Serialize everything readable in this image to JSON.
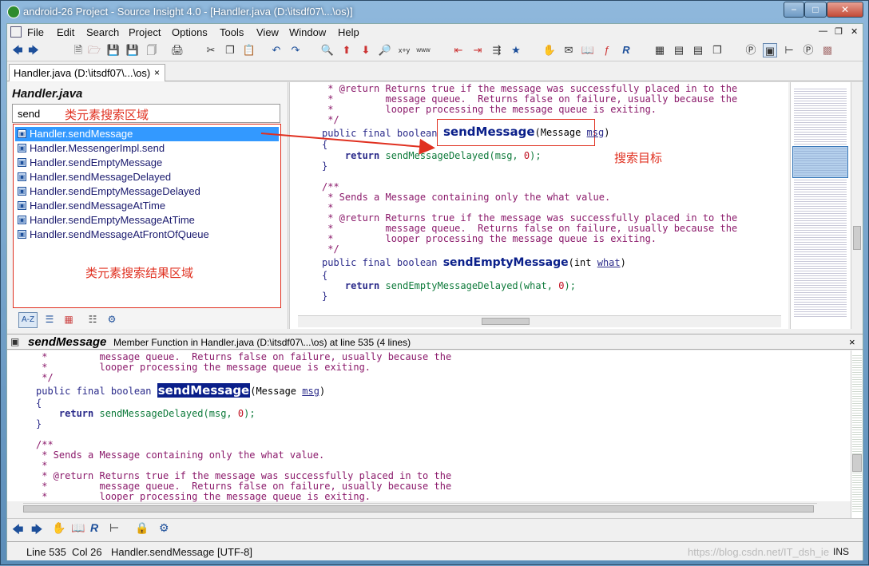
{
  "window": {
    "title": "android-26 Project - Source Insight 4.0 - [Handler.java (D:\\itsdf07\\...\\os)]",
    "min": "−",
    "max": "□",
    "close": "✕"
  },
  "menu": [
    "File",
    "Edit",
    "Search",
    "Project",
    "Options",
    "Tools",
    "View",
    "Window",
    "Help"
  ],
  "tab": {
    "label": "Handler.java (D:\\itsdf07\\...\\os)",
    "close": "×"
  },
  "symbol_panel": {
    "file_name": "Handler.java",
    "search_value": "send",
    "search_annotation": "类元素搜索区域",
    "results_annotation": "类元素搜索结果区域",
    "results": [
      "Handler.sendMessage",
      "Handler.MessengerImpl.send",
      "Handler.sendEmptyMessage",
      "Handler.sendMessageDelayed",
      "Handler.sendEmptyMessageDelayed",
      "Handler.sendMessageAtTime",
      "Handler.sendEmptyMessageAtTime",
      "Handler.sendMessageAtFrontOfQueue"
    ],
    "tools": [
      "A-Z",
      "☰",
      "▦",
      "☷",
      "⚙"
    ]
  },
  "editor": {
    "target_annotation": "搜索目标",
    "lines": {
      "l1": " * @return Returns true if the message was successfully placed in to the",
      "l2": " *         message queue.  Returns false on failure, usually because the",
      "l3": " *         looper processing the message queue is exiting.",
      "l4": " */",
      "decl_kw": "public final boolean ",
      "decl_fn": "sendMessage",
      "decl_open": "(Message ",
      "decl_var": "msg",
      "decl_close": ")",
      "brace_open": "{",
      "ret_kw": "    return ",
      "ret_fn": "sendMessageDelayed",
      "ret_args": "(msg, ",
      "ret_num": "0",
      "ret_end": ");",
      "brace_close": "}",
      "doc_open": "/**",
      "doc1": " * Sends a Message containing only the what value.",
      "doc2": " *",
      "l5": " * @return Returns true if the message was successfully placed in to the",
      "l6": " *         message queue.  Returns false on failure, usually because the",
      "l7": " *         looper processing the message queue is exiting.",
      "l8": " */",
      "decl2_kw": "public final boolean ",
      "decl2_fn": "sendEmptyMessage",
      "decl2_open": "(int ",
      "decl2_var": "what",
      "decl2_close": ")",
      "brace2_open": "{",
      "ret2_kw": "    return ",
      "ret2_fn": "sendEmptyMessageDelayed",
      "ret2_args": "(what, ",
      "ret2_num": "0",
      "ret2_end": ");",
      "brace2_close": "}"
    }
  },
  "context": {
    "symbol": "sendMessage",
    "info": "Member Function in Handler.java (D:\\itsdf07\\...\\os) at line 535 (4 lines)",
    "close": "×",
    "lines": {
      "c1": " *         message queue.  Returns false on failure, usually because the",
      "c2": " *         looper processing the message queue is exiting.",
      "c3": " */",
      "decl_kw": "public final boolean ",
      "decl_fn": "sendMessage",
      "decl_open": "(Message ",
      "decl_var": "msg",
      "decl_close": ")",
      "brace_open": "{",
      "ret_kw": "    return ",
      "ret_fn": "sendMessageDelayed",
      "ret_args": "(msg, ",
      "ret_num": "0",
      "ret_end": ");",
      "brace_close": "}",
      "doc_open": "/**",
      "doc1": " * Sends a Message containing only the what value.",
      "doc2": " *",
      "c4": " * @return Returns true if the message was successfully placed in to the",
      "c5": " *         message queue.  Returns false on failure, usually because the",
      "c6": " *         looper processing the message queue is exiting."
    }
  },
  "status": {
    "line": "Line 535",
    "col": "Col 26",
    "symbol": "Handler.sendMessage [UTF-8]",
    "watermark": "https://blog.csdn.net/IT_dsh_ie",
    "mode": "INS"
  },
  "colors": {
    "annotation": "#e03020",
    "selection": "#3399ff",
    "comment": "#8b1a6b",
    "function": "#0d7a3a",
    "keyword": "#2a2a8a"
  }
}
